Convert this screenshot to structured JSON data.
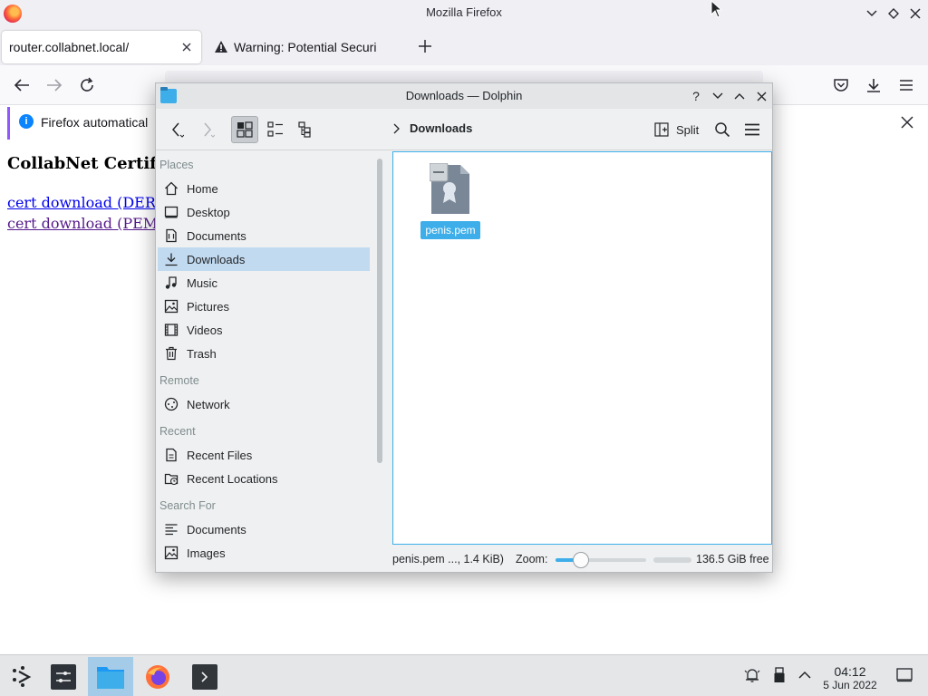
{
  "firefox": {
    "window_title": "Mozilla Firefox",
    "tabs": [
      {
        "label": "router.collabnet.local/"
      },
      {
        "label": "Warning: Potential Securi"
      }
    ],
    "notification": "Firefox automatical",
    "page": {
      "heading": "CollabNet Certific",
      "links": [
        "cert download (DER, W",
        "cert download (PEM,"
      ]
    }
  },
  "dolphin": {
    "window_title": "Downloads — Dolphin",
    "breadcrumb": "Downloads",
    "split_label": "Split",
    "sidebar": {
      "sections": [
        {
          "title": "Places",
          "items": [
            {
              "label": "Home",
              "icon": "home-icon"
            },
            {
              "label": "Desktop",
              "icon": "desktop-icon"
            },
            {
              "label": "Documents",
              "icon": "documents-icon"
            },
            {
              "label": "Downloads",
              "icon": "downloads-icon",
              "selected": true
            },
            {
              "label": "Music",
              "icon": "music-icon"
            },
            {
              "label": "Pictures",
              "icon": "pictures-icon"
            },
            {
              "label": "Videos",
              "icon": "videos-icon"
            },
            {
              "label": "Trash",
              "icon": "trash-icon"
            }
          ]
        },
        {
          "title": "Remote",
          "items": [
            {
              "label": "Network",
              "icon": "network-icon"
            }
          ]
        },
        {
          "title": "Recent",
          "items": [
            {
              "label": "Recent Files",
              "icon": "recent-files-icon"
            },
            {
              "label": "Recent Locations",
              "icon": "recent-locations-icon"
            }
          ]
        },
        {
          "title": "Search For",
          "items": [
            {
              "label": "Documents",
              "icon": "search-documents-icon"
            },
            {
              "label": "Images",
              "icon": "search-images-icon"
            }
          ]
        }
      ]
    },
    "files": [
      {
        "name": "penis.pem",
        "icon": "certificate-file-icon",
        "selected": true
      }
    ],
    "status": {
      "info": "penis.pem ..., 1.4 KiB)",
      "zoom_label": "Zoom:",
      "zoom_level": 0.28,
      "free_space": "136.5 GiB free"
    }
  },
  "taskbar": {
    "time": "04:12",
    "date": "5 Jun 2022"
  },
  "colors": {
    "accent": "#3daee9",
    "selection": "#c2daf0",
    "link": "#0000ee",
    "visited_link": "#551a8b"
  }
}
